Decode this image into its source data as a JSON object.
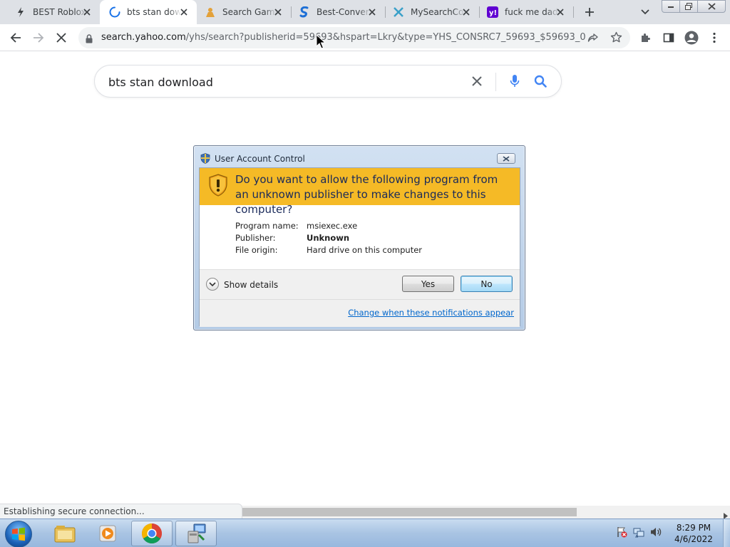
{
  "browser": {
    "tabs": [
      {
        "title": "BEST Roblox",
        "icon": "lightning-icon"
      },
      {
        "title": "bts stan dow",
        "icon": "loading-spinner-icon",
        "active": true
      },
      {
        "title": "Search Game",
        "icon": "person-icon"
      },
      {
        "title": "Best-Convert",
        "icon": "s-logo-icon"
      },
      {
        "title": "MySearchCo",
        "icon": "x-logo-icon"
      },
      {
        "title": "fuck me dad",
        "icon": "yahoo-icon"
      }
    ],
    "url_host": "search.yahoo.com",
    "url_path": "/yhs/search?publisherid=59693&hspart=Lkry&type=YHS_CONSRC7_59693_$59693_0017..."
  },
  "page": {
    "search_query": "bts stan download"
  },
  "uac": {
    "title": "User Account Control",
    "question": "Do you want to allow the following program from an unknown publisher to make changes to this computer?",
    "info": [
      {
        "key": "Program name:",
        "value": "msiexec.exe"
      },
      {
        "key": "Publisher:",
        "value": "Unknown"
      },
      {
        "key": "File origin:",
        "value": "Hard drive on this computer"
      }
    ],
    "show_details": "Show details",
    "yes_label": "Yes",
    "no_label": "No",
    "change_link": "Change when these notifications appear"
  },
  "status": {
    "text": "Establishing secure connection..."
  },
  "taskbar": {
    "time": "8:29 PM",
    "date": "4/6/2022"
  },
  "colors": {
    "uac_banner": "#f5ba26",
    "link": "#0066cc",
    "search_blue": "#4285f4"
  }
}
